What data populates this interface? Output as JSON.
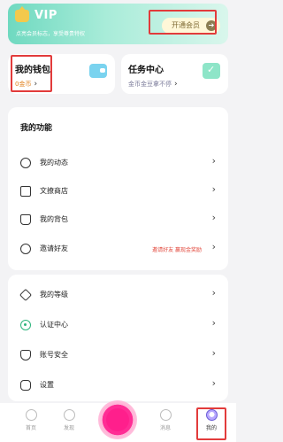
{
  "vip": {
    "title": "VIP",
    "subtitle": "点亮会员标志，享受尊贵特权",
    "open_button": "开通会员",
    "arrow": "➔"
  },
  "wallet": {
    "title": "我的钱包",
    "sub": "0金币",
    "chevron": "›"
  },
  "task": {
    "title": "任务中心",
    "sub": "金币金豆拿不停",
    "chevron": "›"
  },
  "functions": {
    "heading": "我的功能",
    "items": [
      {
        "label": "我的动态",
        "icon": "moments-icon"
      },
      {
        "label": "文撩商店",
        "icon": "shop-icon"
      },
      {
        "label": "我的背包",
        "icon": "backpack-icon"
      },
      {
        "label": "邀请好友",
        "icon": "invite-icon",
        "extra": "邀请好友 赢现金奖励"
      }
    ]
  },
  "settings": {
    "items": [
      {
        "label": "我的等级",
        "icon": "level-icon"
      },
      {
        "label": "认证中心",
        "icon": "verification-icon"
      },
      {
        "label": "账号安全",
        "icon": "security-icon"
      },
      {
        "label": "设置",
        "icon": "settings-icon"
      }
    ]
  },
  "chevron": "›",
  "tabbar": {
    "items": [
      {
        "label": "首页",
        "icon": "home-icon"
      },
      {
        "label": "发现",
        "icon": "discover-icon"
      },
      {
        "label": "消息",
        "icon": "message-icon"
      },
      {
        "label": "我的",
        "icon": "profile-icon"
      }
    ]
  },
  "colors": {
    "vip_gradient_start": "#6fd9c0",
    "wallet_accent": "#e07f1a",
    "invite_accent": "#e2463a",
    "center_button": "#ff1f8c",
    "annotation_box": "#e23b3b"
  }
}
